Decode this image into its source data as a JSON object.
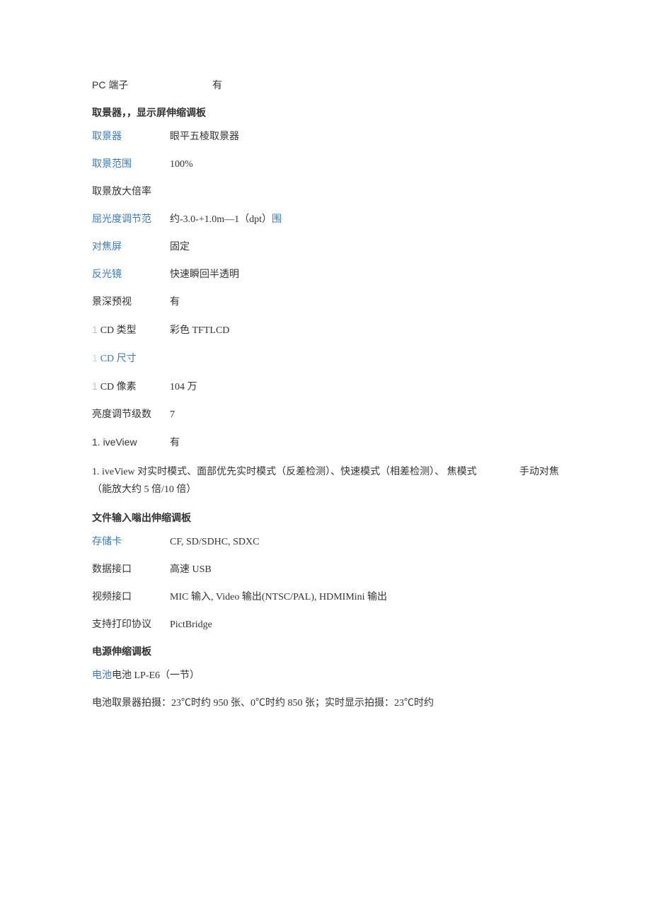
{
  "top_row": {
    "label": "PC 端子",
    "value": "有"
  },
  "section1": {
    "title": "取景器，，显示屏伸缩调板",
    "rows": [
      {
        "label": "取景器",
        "labelClass": "link",
        "value": "眼平五棱取景器"
      },
      {
        "label": "取景范围",
        "labelClass": "link",
        "value": "100%"
      },
      {
        "label": "取景放大倍率",
        "labelClass": "",
        "value": ""
      },
      {
        "label": "屈光度调节范",
        "labelClass": "link",
        "value": "约-3.0-+1.0m—1（dpt）围",
        "valueSuffixClass": "link",
        "valueSuffix": ""
      },
      {
        "label": "对焦屏",
        "labelClass": "link",
        "value": "固定"
      },
      {
        "label": "反光镜",
        "labelClass": "link",
        "value": "快速瞬回半透明"
      },
      {
        "label": "景深预视",
        "labelClass": "",
        "value": "有"
      },
      {
        "label": "CD 类型",
        "labelClass": "",
        "prefix": "1",
        "value": "彩色 TFTLCD"
      },
      {
        "label": "CD 尺寸",
        "labelClass": "link",
        "prefix": "1",
        "value": ""
      },
      {
        "label": "CD 像素",
        "labelClass": "",
        "prefix": "1",
        "value": "104 万"
      },
      {
        "label": "亮度调节级数",
        "labelClass": "",
        "value": "7"
      }
    ],
    "liveview_row": {
      "label": "1. iveView",
      "value": "有"
    },
    "liveview_para_a": "1. iveView 对实时模式、面部优先实时模式（反差检测）、快速模式（相差检测）、 焦模式",
    "liveview_para_right": "手动对焦",
    "liveview_para_b": "（能放大约 5 倍/10 倍）"
  },
  "section2": {
    "title": "文件输入嗡出伸缩调板",
    "rows": [
      {
        "label": "存储卡",
        "labelClass": "link",
        "value": "CF, SD/SDHC, SDXC"
      },
      {
        "label": "数据接口",
        "labelClass": "",
        "value": "高速 USB"
      },
      {
        "label": "视频接口",
        "labelClass": "",
        "value": "MIC 输入, Video 输出(NTSC/PAL), HDMIMini 输出"
      },
      {
        "label": "支持打印协议",
        "labelClass": "",
        "value": "PictBridge"
      }
    ]
  },
  "section3": {
    "title": "电源伸缩调板",
    "battery_line_label": "电池",
    "battery_line_value": "电池 LP-E6（一节）",
    "battery_detail": "电池取景器拍摄：23℃时约 950 张、0℃时约 850 张；实时显示拍摄：23℃时约"
  }
}
